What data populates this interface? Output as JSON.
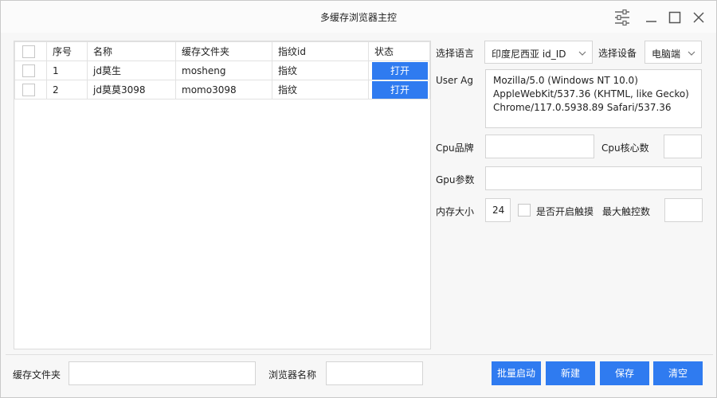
{
  "window": {
    "title": "多缓存浏览器主控"
  },
  "table": {
    "headers": [
      "序号",
      "名称",
      "缓存文件夹",
      "指纹id",
      "状态"
    ],
    "rows": [
      {
        "index": "1",
        "name": "jd莫生",
        "folder": "mosheng",
        "fingerprint": "指纹",
        "action": "打开"
      },
      {
        "index": "2",
        "name": "jd莫莫3098",
        "folder": "momo3098",
        "fingerprint": "指纹",
        "action": "打开"
      }
    ]
  },
  "settings": {
    "language_label": "选择语言",
    "language_value": "印度尼西亚  id_ID",
    "device_label": "选择设备",
    "device_value": "电脑端",
    "ua_label": "User Ag",
    "ua_lines": [
      "Mozilla/5.0 (Windows NT 10.0)",
      "AppleWebKit/537.36 (KHTML, like Gecko)",
      "Chrome/117.0.5938.89 Safari/537.36"
    ],
    "cpu_brand_label": "Cpu品牌",
    "cpu_brand_value": "",
    "cpu_cores_label": "Cpu核心数",
    "cpu_cores_value": "",
    "gpu_label": "Gpu参数",
    "gpu_value": "",
    "memory_label": "内存大小",
    "memory_value": "24",
    "touch_label": "是否开启触摸",
    "max_touch_label": "最大触控数",
    "max_touch_value": ""
  },
  "bottom": {
    "folder_label": "缓存文件夹",
    "folder_value": "",
    "browser_name_label": "浏览器名称",
    "browser_name_value": "",
    "batch_start": "批量启动",
    "new": "新建",
    "save": "保存",
    "clear": "清空"
  },
  "colors": {
    "accent": "#2f7bf0",
    "border": "#d4d4d4",
    "window_bg": "#f7f7f7"
  },
  "icons": [
    "settings-sliders-icon",
    "minimize-icon",
    "maximize-icon",
    "close-icon",
    "chevron-down-icon"
  ]
}
